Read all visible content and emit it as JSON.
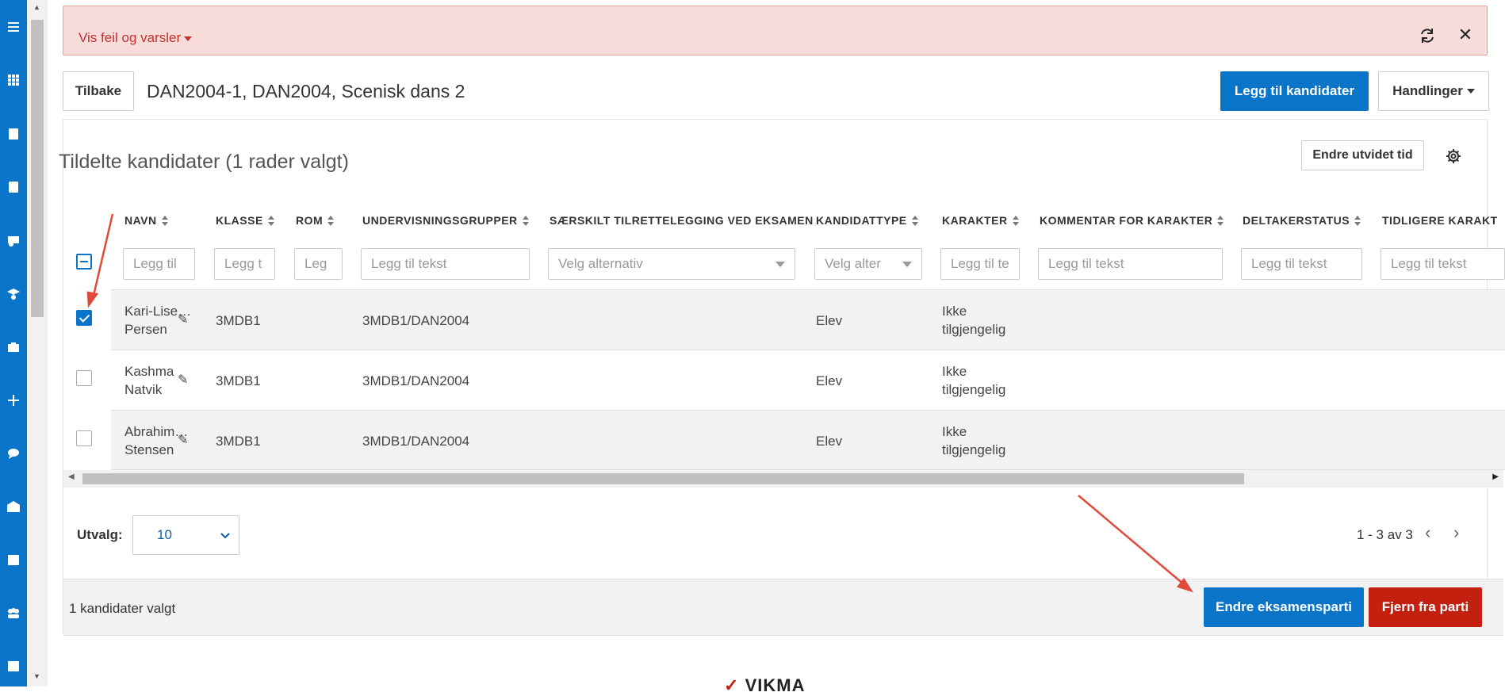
{
  "alert": {
    "text": "Vis feil og varsler"
  },
  "header": {
    "back_label": "Tilbake",
    "title": "DAN2004-1, DAN2004, Scenisk dans 2",
    "add_label": "Legg til kandidater",
    "actions_label": "Handlinger"
  },
  "panel": {
    "title": "Tildelte kandidater (1 rader valgt)",
    "extend_label": "Endre utvidet tid"
  },
  "table": {
    "columns": [
      "NAVN",
      "KLASSE",
      "ROM",
      "UNDERVISNINGSGRUPPER",
      "SÆRSKILT TILRETTELEGGING VED EKSAMEN",
      "KANDIDATTYPE",
      "KARAKTER",
      "KOMMENTAR FOR KARAKTER",
      "DELTAKERSTATUS",
      "TIDLIGERE KARAKT"
    ],
    "filters": [
      "Legg til",
      "Legg t",
      "Leg",
      "Legg til tekst",
      "Velg alternativ",
      "Velg alter",
      "Legg til te",
      "Legg til tekst",
      "Legg til tekst",
      "Legg til tekst"
    ],
    "rows": [
      {
        "name1": "Kari-Lise…",
        "name2": "Persen",
        "klasse": "3MDB1",
        "grupper": "3MDB1/DAN2004",
        "type": "Elev",
        "kar1": "Ikke",
        "kar2": "tilgjengelig",
        "checked": true
      },
      {
        "name1": "Kashma",
        "name2": "Natvik",
        "klasse": "3MDB1",
        "grupper": "3MDB1/DAN2004",
        "type": "Elev",
        "kar1": "Ikke",
        "kar2": "tilgjengelig",
        "checked": false
      },
      {
        "name1": "Abrahim…",
        "name2": "Stensen",
        "klasse": "3MDB1",
        "grupper": "3MDB1/DAN2004",
        "type": "Elev",
        "kar1": "Ikke",
        "kar2": "tilgjengelig",
        "checked": false
      }
    ]
  },
  "pagination": {
    "label": "Utvalg:",
    "size": "10",
    "range": "1 - 3 av 3"
  },
  "footer": {
    "selected": "1 kandidater valgt",
    "change_label": "Endre eksamensparti",
    "remove_label": "Fjern fra parti"
  },
  "colors": {
    "primary": "#0a74c9",
    "danger": "#c4200f",
    "alert_bg": "#f8dcda"
  }
}
